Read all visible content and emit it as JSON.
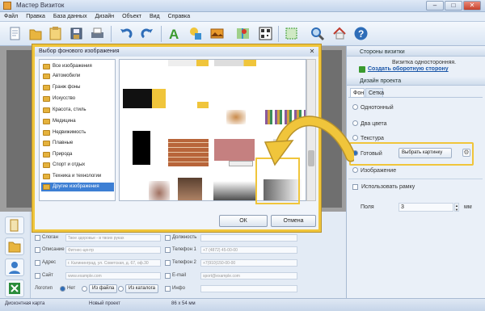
{
  "window": {
    "title": "Мастер Визиток",
    "min": "–",
    "max": "□",
    "close": "✕"
  },
  "menu": [
    "Файл",
    "Правка",
    "База данных",
    "Дизайн",
    "Объект",
    "Вид",
    "Справка"
  ],
  "toolbar": {
    "icons": [
      "new-icon",
      "open-folder-icon",
      "open-template-icon",
      "save-icon",
      "print-icon",
      "undo-icon",
      "redo-icon",
      "text-icon",
      "shapes-icon",
      "image-icon",
      "map-icon",
      "qr-code-icon",
      "crop-icon",
      "search-icon",
      "house-icon",
      "help-icon"
    ]
  },
  "dialog": {
    "title": "Выбор фонового изображения",
    "close": "✕",
    "categories": [
      "Все изображения",
      "Автомобили",
      "Гранж фоны",
      "Искусство",
      "Красота, стиль",
      "Медицина",
      "Недвижимость",
      "Плавные",
      "Природа",
      "Спорт и отдых",
      "Техника и технологии",
      "Другие изображения"
    ],
    "selected_index": 11,
    "ok": "ОК",
    "cancel": "Отмена"
  },
  "right": {
    "sides_header": "Стороны визитки",
    "sides_text": "Визитка односторонняя.",
    "sides_link": "Создать оборотную сторону",
    "design_header": "Дизайн проекта",
    "tabs": [
      "Фон",
      "Сетка"
    ],
    "options": [
      "Однотонный",
      "Два цвета",
      "Текстура",
      "Готовый",
      "Изображение"
    ],
    "choose_btn": "Выбрать картинку",
    "use_frame": "Использовать рамку",
    "margins_label": "Поля",
    "margins_value": "3",
    "margins_unit": "мм"
  },
  "fields": {
    "slogan_label": "Слоган",
    "slogan_value": "Твое здоровье - в твоих руках",
    "desc_label": "Описание",
    "desc_value": "Фитнес-центр",
    "addr_label": "Адрес",
    "addr_value": "г. Калининград, ул. Советская, д. 67, оф.30",
    "site_label": "Сайт",
    "site_value": "www.example.com",
    "logo_label": "Логотип",
    "logo_none": "Нет",
    "logo_file": "Из файла",
    "logo_catalog": "Из каталога",
    "pos_label": "Должность",
    "phone1_label": "Телефон 1",
    "phone1_value": "+7 (4872) 45-00-00",
    "phone2_label": "Телефон 2",
    "phone2_value": "+7(910)150-00-00",
    "email_label": "E-mail",
    "email_value": "sport@example.com",
    "info_label": "Инфо"
  },
  "status": {
    "type": "Дисконтная карта",
    "project": "Новый проект",
    "size": "86 х 54 мм"
  },
  "colors": {
    "highlight": "#f0c53b",
    "selection": "#3d7fd4",
    "link": "#1a56a8"
  }
}
